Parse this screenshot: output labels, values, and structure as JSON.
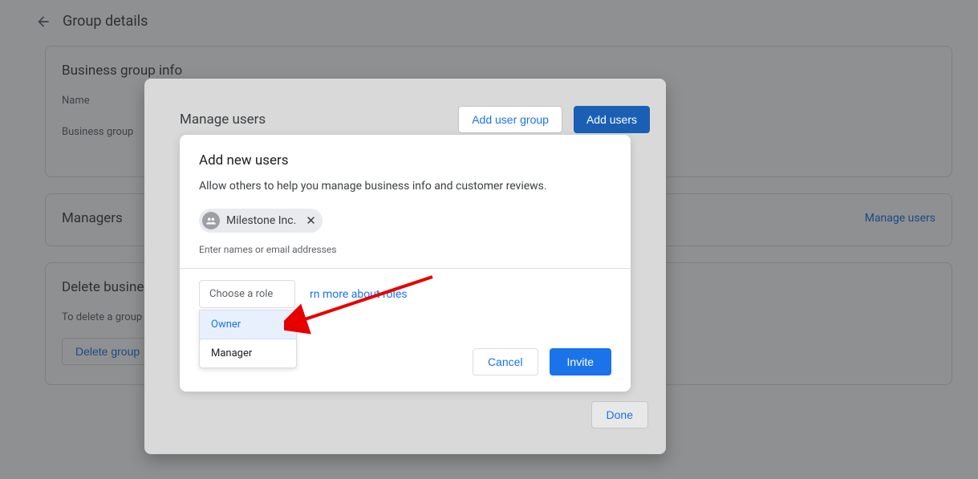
{
  "header": {
    "title": "Group details"
  },
  "cards": {
    "info": {
      "heading": "Business group info",
      "name_label": "Name",
      "group_label": "Business group"
    },
    "managers": {
      "heading": "Managers",
      "manage_link": "Manage users"
    },
    "delete_section": {
      "heading": "Delete busine",
      "body": "To delete a group",
      "button": "Delete group"
    }
  },
  "outer_modal": {
    "title": "Manage users",
    "add_group_btn": "Add user group",
    "add_users_btn": "Add users",
    "done_btn": "Done"
  },
  "inner_modal": {
    "title": "Add new users",
    "description": "Allow others to help you manage business info and customer reviews.",
    "chip_label": "Milestone Inc.",
    "input_hint": "Enter names or email addresses",
    "role_placeholder": "Choose a role",
    "role_options": [
      "Owner",
      "Manager"
    ],
    "learn_more": "rn more about roles",
    "cancel_btn": "Cancel",
    "invite_btn": "Invite"
  }
}
